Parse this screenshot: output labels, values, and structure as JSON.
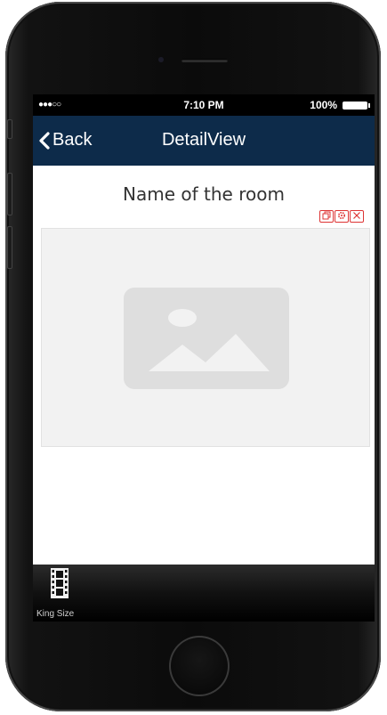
{
  "status_bar": {
    "signal": "●●●○○",
    "time": "7:10 PM",
    "battery": "100%"
  },
  "nav_bar": {
    "back_label": "Back",
    "title": "DetailView"
  },
  "content": {
    "room_title": "Name of the room",
    "image_placeholder_icon": "image-placeholder-icon"
  },
  "widget_tools": {
    "icons": [
      "copy-icon",
      "settings-icon",
      "close-icon"
    ],
    "color": "#dd3333"
  },
  "tab_bar": {
    "items": [
      {
        "label": "King Size",
        "icon": "film-icon"
      }
    ]
  },
  "colors": {
    "nav_bar": "#0d2b4a",
    "screen_bg": "#ffffff",
    "placeholder_bg": "#f2f2f2"
  }
}
